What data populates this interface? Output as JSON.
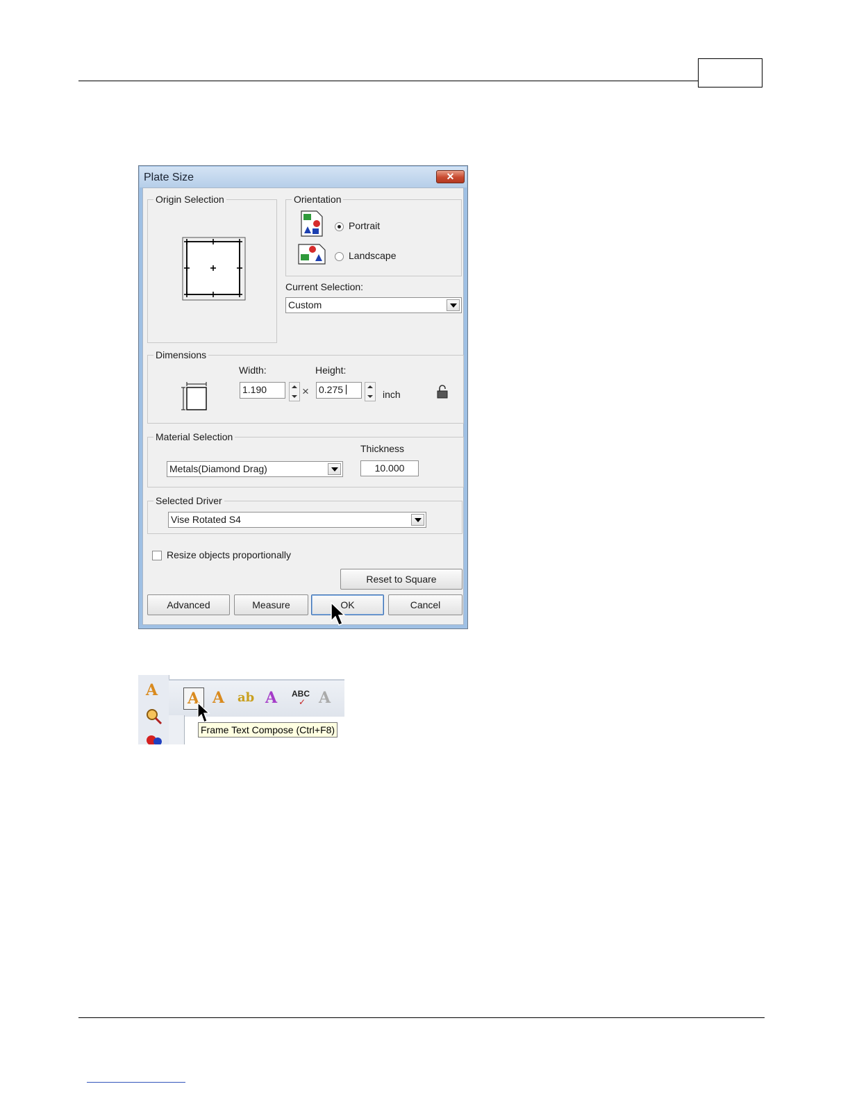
{
  "dialog": {
    "title": "Plate Size",
    "close_glyph": "✕",
    "origin_selection_label": "Origin Selection",
    "orientation_label": "Orientation",
    "portrait_label": "Portrait",
    "landscape_label": "Landscape",
    "current_selection_label": "Current Selection:",
    "current_selection_value": "Custom",
    "dimensions_label": "Dimensions",
    "width_label": "Width:",
    "width_value": "1.190",
    "height_label": "Height:",
    "height_value": "0.275",
    "times_glyph": "×",
    "unit": "inch",
    "material_selection_label": "Material Selection",
    "material_value": "Metals(Diamond Drag)",
    "thickness_label": "Thickness",
    "thickness_value": "10.000",
    "selected_driver_label": "Selected Driver",
    "driver_value": "Vise Rotated S4",
    "resize_label": "Resize objects proportionally",
    "reset_button": "Reset to Square",
    "advanced_button": "Advanced",
    "measure_button": "Measure",
    "ok_button": "OK",
    "cancel_button": "Cancel",
    "selected_orientation": "portrait",
    "resize_checked": false
  },
  "toolbar": {
    "tooltip": "Frame Text Compose (Ctrl+F8)",
    "abc_label": "ABC",
    "icons": [
      "text-tool-icon",
      "zoom-icon",
      "color-icon",
      "frame-text-compose-icon",
      "text-icon",
      "text-fit-icon",
      "text-effect-icon",
      "spell-check-icon",
      "text-shadow-icon"
    ]
  }
}
